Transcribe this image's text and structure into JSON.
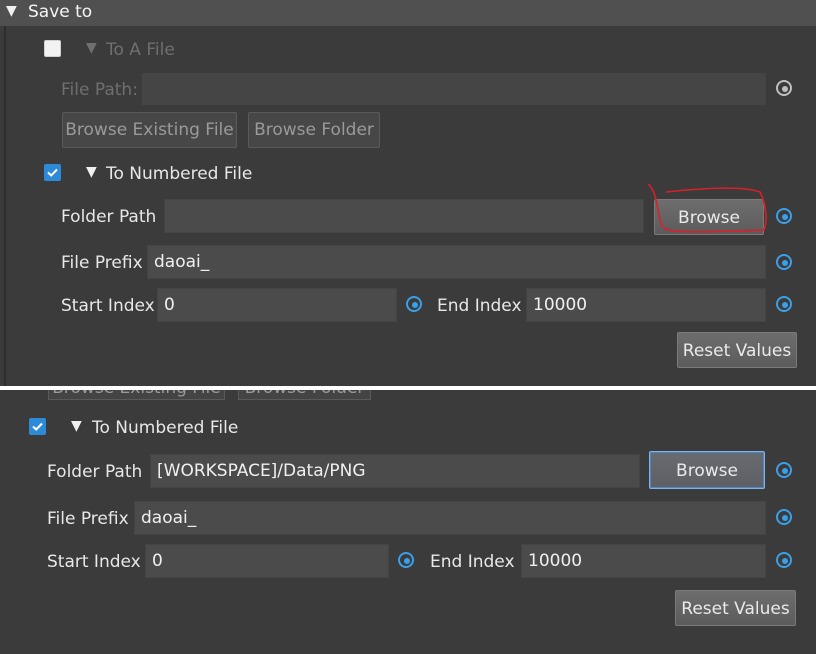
{
  "top_panel": {
    "header": {
      "title": "Save to",
      "arrow_icon": "triangle-down-icon"
    },
    "to_a_file": {
      "checked": false,
      "label": "To A File",
      "file_path_label": "File Path:",
      "file_path_value": "",
      "browse_existing_label": "Browse Existing File",
      "browse_folder_label": "Browse Folder"
    },
    "to_numbered_file": {
      "checked": true,
      "label": "To Numbered File",
      "folder_path_label": "Folder Path",
      "folder_path_value": "",
      "browse_label": "Browse",
      "file_prefix_label": "File Prefix",
      "file_prefix_value": "daoai_",
      "start_index_label": "Start Index",
      "start_index_value": "0",
      "end_index_label": "End Index",
      "end_index_value": "10000",
      "reset_label": "Reset Values"
    },
    "annotation_color": "#d9202a"
  },
  "bottom_panel": {
    "ghost_buttons": {
      "browse_existing_label": "Browse Existing File",
      "browse_folder_label": "Browse Folder"
    },
    "to_numbered_file": {
      "checked": true,
      "label": "To Numbered File",
      "folder_path_label": "Folder Path",
      "folder_path_value": "[WORKSPACE]/Data/PNG",
      "browse_label": "Browse",
      "file_prefix_label": "File Prefix",
      "file_prefix_value": "daoai_",
      "start_index_label": "Start Index",
      "start_index_value": "0",
      "end_index_label": "End Index",
      "end_index_value": "10000",
      "reset_label": "Reset Values"
    }
  },
  "colors": {
    "accent_blue": "#3aa0e8",
    "panel_bg": "#3b3b3b",
    "header_bg": "#505050"
  }
}
